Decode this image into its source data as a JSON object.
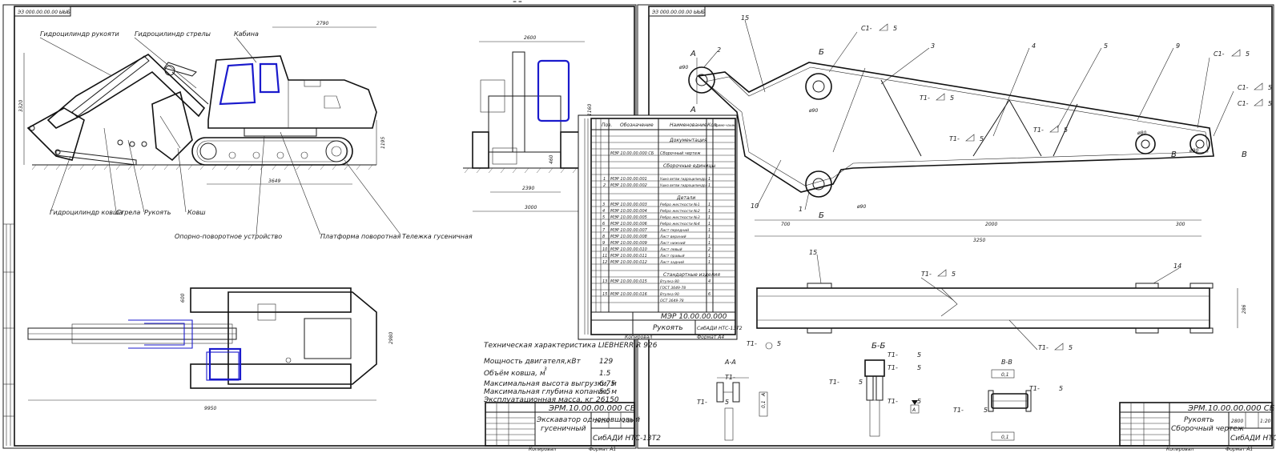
{
  "sheet_left": {
    "stamp_code": "ЭЗ 000.00.00.00 ЫЫБ",
    "labels": {
      "arm_cylinder": "Гидроцилиндр рукояти",
      "boom_cylinder": "Гидроцилиндр стрелы",
      "cab": "Кабина",
      "bucket_cylinder": "Гидроцилиндр ковша",
      "boom": "Стрела",
      "arm": "Рукоять",
      "bucket": "Ковш",
      "slewing_ring": "Опорно-поворотное устройство",
      "turntable": "Платформа поворотная",
      "crawler": "Тележка гусеничная"
    },
    "dimensions": {
      "d2790": "2790",
      "d3320": "3320",
      "d1195": "1195",
      "d3649": "3649",
      "d2600": "2600",
      "d1160": "1160",
      "d460": "460",
      "d2390": "2390",
      "d3000": "3000",
      "d600": "600",
      "d2980": "2980",
      "d9950": "9950"
    },
    "tech": {
      "heading": "Техническая характеристика LIEBHERR R 926",
      "rows": [
        {
          "label": "Мощность двигателя,кВт",
          "value": "129"
        },
        {
          "label": "Объём ковша, м",
          "value": "1.5"
        },
        {
          "label": "Максимальная высота выгрузки, м",
          "value": "6.75"
        },
        {
          "label": "Максимальная глубина копания, м",
          "value": "5.5"
        },
        {
          "label": "Эксплуатационная масса, кг",
          "value": "26150"
        }
      ],
      "exponent": "3"
    },
    "title_block": {
      "code": "ЭРМ.10.00.00.000 СБ",
      "name_line1": "Экскаватор одноковшовый",
      "name_line2": "гусеничный",
      "org": "СибАДИ НТС-13Т2",
      "mass": "26150",
      "scale": "1:35",
      "format": "Копировал",
      "format2": "Формат А1"
    }
  },
  "spec_sheet": {
    "headers": {
      "format": "Формат",
      "zone": "Зона",
      "pos": "Поз.",
      "designation": "Обозначение",
      "name": "Наименование",
      "qty": "Кол.",
      "note": "Приме-чание"
    },
    "sections": {
      "docs": "Документация",
      "std_assembly": "Сборочные единицы",
      "parts": "Детали",
      "std_items": "Стандартные изделия"
    },
    "rows_docs": [
      {
        "pos": "",
        "des": "МЭР 10.00.00.000 СБ",
        "name": "Сборочный чертеж",
        "qty": ""
      }
    ],
    "rows_asm": [
      {
        "pos": "1",
        "des": "МЭР 10.00.00.001",
        "name": "Ушко ветви гидроцилиндра",
        "qty": "1"
      },
      {
        "pos": "2",
        "des": "МЭР 10.00.00.002",
        "name": "Ушко ветви гидроцилиндра",
        "qty": "1"
      }
    ],
    "rows_parts": [
      {
        "pos": "3",
        "des": "МЭР 10.00.00.003",
        "name": "Ребро жесткости №1",
        "qty": "1"
      },
      {
        "pos": "4",
        "des": "МЭР 10.00.00.004",
        "name": "Ребро жесткости №2",
        "qty": "1"
      },
      {
        "pos": "5",
        "des": "МЭР 10.00.00.005",
        "name": "Ребро жесткости №3",
        "qty": "1"
      },
      {
        "pos": "6",
        "des": "МЭР 10.00.00.006",
        "name": "Ребро жесткости №4",
        "qty": "1"
      },
      {
        "pos": "7",
        "des": "МЭР 10.00.00.007",
        "name": "Лист передний",
        "qty": "1"
      },
      {
        "pos": "8",
        "des": "МЭР 10.00.00.008",
        "name": "Лист верхний",
        "qty": "1"
      },
      {
        "pos": "9",
        "des": "МЭР 10.00.00.009",
        "name": "Лист нижний",
        "qty": "1"
      },
      {
        "pos": "10",
        "des": "МЭР 10.00.00.010",
        "name": "Лист левый",
        "qty": "2"
      },
      {
        "pos": "11",
        "des": "МЭР 10.00.00.011",
        "name": "Лист правый",
        "qty": "1"
      },
      {
        "pos": "12",
        "des": "МЭР 10.00.00.012",
        "name": "Лист задний",
        "qty": "1"
      }
    ],
    "rows_std": [
      {
        "pos": "13",
        "des": "МЭР 10.00.00.015",
        "name": "Втулка 80",
        "qty": "4"
      },
      {
        "pos": "",
        "des": "",
        "name": "ГОСТ 3649-78",
        "qty": ""
      },
      {
        "pos": "15",
        "des": "МЭР 10.00.00.016",
        "name": "Втулка 90",
        "qty": "6"
      },
      {
        "pos": "",
        "des": "",
        "name": "ОСТ 3649-78",
        "qty": ""
      }
    ],
    "footer_code": "МЭР 10.00.00.000",
    "footer_name": "Рукоять",
    "footer_org": "СибАДИ НТС-13Т2",
    "copy": "Копировал",
    "format": "Формат А4"
  },
  "sheet_right": {
    "stamp_code": "ЭЗ 000.00.00.00 ЫЫБ",
    "welds": {
      "c1": "С1-",
      "t1": "Т1-",
      "leg": "5"
    },
    "positions": [
      "1",
      "2",
      "3",
      "4",
      "5",
      "9",
      "10",
      "11",
      "14",
      "15"
    ],
    "section_letters": {
      "a": "А",
      "b": "Б",
      "v": "В",
      "aa": "А-А",
      "bb": "Б-Б",
      "vv": "В-В"
    },
    "dimensions": {
      "d700": "700",
      "d2000": "2000",
      "d300": "300",
      "d3250": "3250",
      "d286": "286",
      "dia90": "ø90",
      "dia80": "ø80"
    },
    "title_block": {
      "code": "ЭРМ.10.00.00.000 СБ",
      "name_line1": "Рукоять",
      "name_line2": "Сборочный чертеж",
      "org": "СибАДИ НТС-13Т2",
      "mass": "2800",
      "scale": "1:20",
      "copy": "Копировал",
      "format": "Формат А1"
    },
    "tolerances": {
      "t1": "0,1",
      "t2": "0,1",
      "t3": "0,1",
      "t4": "0,1",
      "base_a": "А"
    }
  }
}
